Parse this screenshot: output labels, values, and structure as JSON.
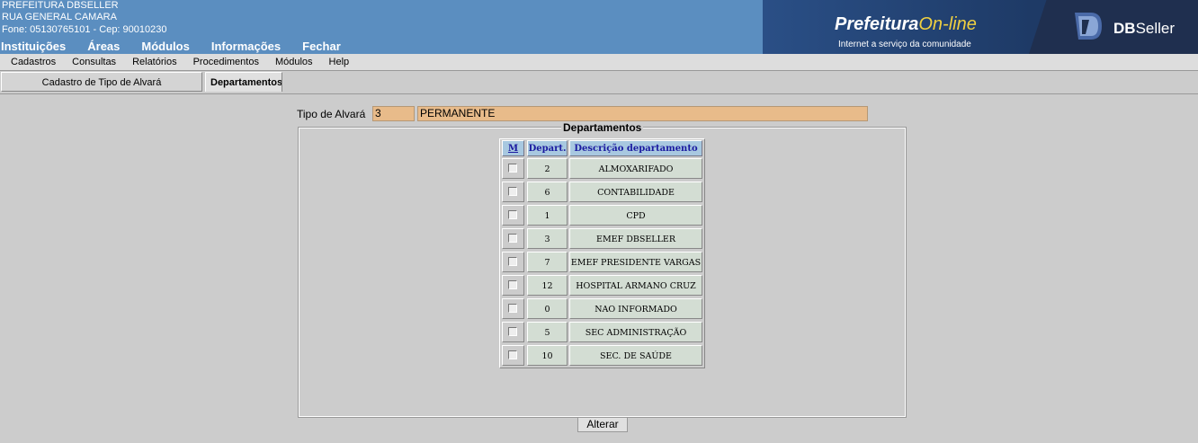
{
  "header": {
    "line1": "PREFEITURA DBSELLER",
    "line2": "RUA GENERAL CAMARA",
    "line3": "Fone: 05130765101  -  Cep: 90010230",
    "main_menu": [
      "Instituições",
      "Áreas",
      "Módulos",
      "Informações",
      "Fechar"
    ],
    "logo_main": "Prefeitura",
    "logo_online": "On-line",
    "logo_sub": "Internet a serviço da comunidade",
    "dbs_bold": "DB",
    "dbs_rest": "Seller"
  },
  "sub_menu": [
    "Cadastros",
    "Consultas",
    "Relatórios",
    "Procedimentos",
    "Módulos",
    "Help"
  ],
  "tabs": {
    "cadastro": "Cadastro de Tipo de Alvará",
    "departamentos": "Departamentos"
  },
  "form": {
    "tipo_label": "Tipo de Alvará",
    "tipo_code": "3",
    "tipo_desc": "PERMANENTE",
    "legend": "Departamentos",
    "col_m": "M",
    "col_depart": "Depart.",
    "col_desc": "Descrição departamento",
    "rows": [
      {
        "code": "2",
        "name": "ALMOXARIFADO"
      },
      {
        "code": "6",
        "name": "CONTABILIDADE"
      },
      {
        "code": "1",
        "name": "CPD"
      },
      {
        "code": "3",
        "name": "EMEF DBSELLER"
      },
      {
        "code": "7",
        "name": "EMEF PRESIDENTE VARGAS"
      },
      {
        "code": "12",
        "name": "HOSPITAL ARMANO CRUZ"
      },
      {
        "code": "0",
        "name": "NAO INFORMADO"
      },
      {
        "code": "5",
        "name": "SEC ADMINISTRAÇÃO"
      },
      {
        "code": "10",
        "name": "SEC. DE SAÚDE"
      }
    ],
    "button_label": "Alterar"
  },
  "colors": {
    "header_bg": "#5b8ec0",
    "field_bg": "#e8bb8a",
    "grid_header_bg": "#a8c8e0",
    "grid_cell_bg": "#d3ddd3"
  }
}
